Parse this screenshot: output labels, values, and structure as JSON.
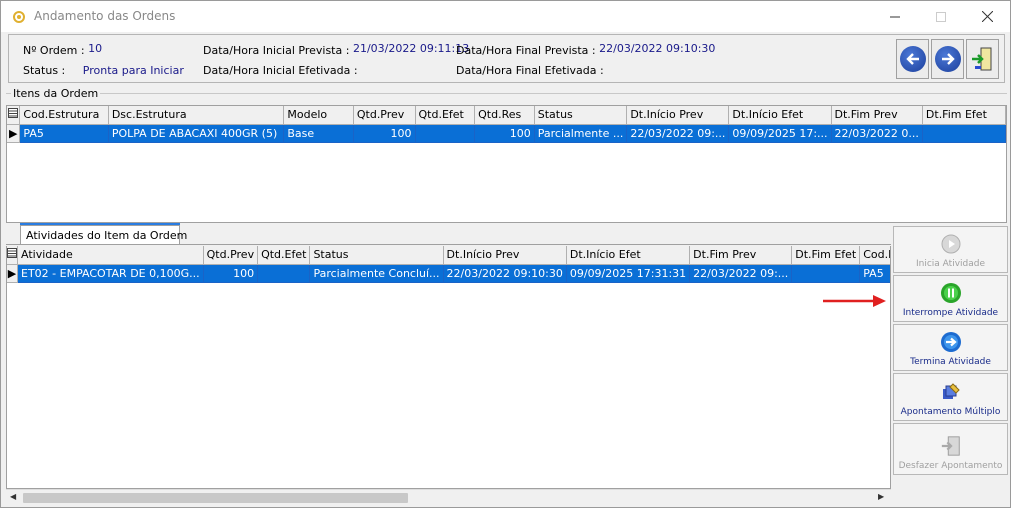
{
  "window": {
    "title": "Andamento das Ordens"
  },
  "header": {
    "ordem_label": "Nº Ordem :",
    "ordem_value": "10",
    "status_label": "Status :",
    "status_value": "Pronta para Iniciar",
    "dt_ini_prev_label": "Data/Hora Inicial Prevista :",
    "dt_ini_prev_value": "21/03/2022 09:11:13",
    "dt_ini_efet_label": "Data/Hora Inicial Efetivada :",
    "dt_fim_prev_label": "Data/Hora Final Prevista :",
    "dt_fim_prev_value": "22/03/2022 09:10:30",
    "dt_fim_efet_label": "Data/Hora Final Efetivada :"
  },
  "itens": {
    "group_label": "Itens da Ordem",
    "columns": [
      "Cod.Estrutura",
      "Dsc.Estrutura",
      "Modelo",
      "Qtd.Prev",
      "Qtd.Efet",
      "Qtd.Res",
      "Status",
      "Dt.Início Prev",
      "Dt.Início Efet",
      "Dt.Fim Prev",
      "Dt.Fim Efet"
    ],
    "rows": [
      [
        "PA5",
        "POLPA DE ABACAXI 400GR  (5)",
        "Base",
        "100",
        "",
        "100",
        "Parcialmente ...",
        "22/03/2022 09:...",
        "09/09/2025 17:...",
        "22/03/2022 0...",
        ""
      ]
    ]
  },
  "atividades": {
    "tab_label": "Atividades do Item da Ordem",
    "columns": [
      "Atividade",
      "Qtd.Prev",
      "Qtd.Efet",
      "Status",
      "Dt.Início Prev",
      "Dt.Início Efet",
      "Dt.Fim Prev",
      "Dt.Fim Efet",
      "Cod.Estr.Feita"
    ],
    "rows": [
      [
        "ET02 - EMPACOTAR DE 0,100G...",
        "100",
        "",
        "Parcialmente Concluí...",
        "22/03/2022 09:10:30",
        "09/09/2025 17:31:31",
        "22/03/2022 09:...",
        "",
        "PA5"
      ]
    ]
  },
  "actions": {
    "inicia": "Inicia Atividade",
    "interrompe": "Interrompe Atividade",
    "termina": "Termina Atividade",
    "apontamento": "Apontamento Múltiplo",
    "desfazer": "Desfazer Apontamento"
  },
  "colors": {
    "selection": "#0a6fd6",
    "accent_red": "#e02020",
    "label_blue": "#1a2c8a"
  }
}
